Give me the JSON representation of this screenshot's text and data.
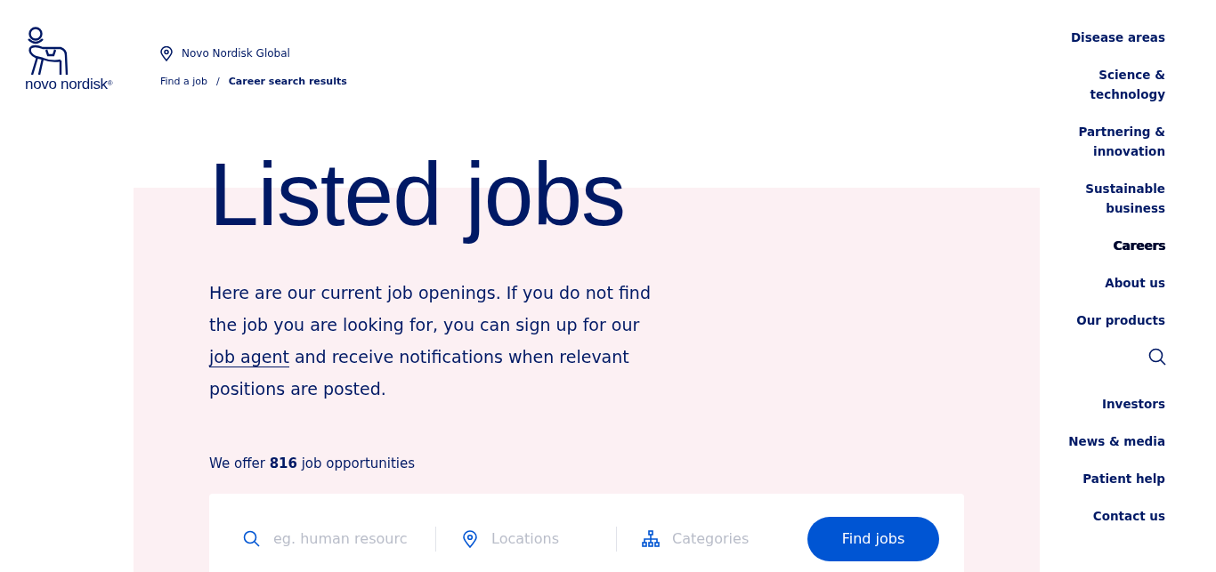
{
  "logo": {
    "text": "novo nordisk",
    "mark": "®"
  },
  "site": "Novo Nordisk Global",
  "breadcrumb": {
    "separator": "/",
    "items": [
      {
        "label": "Find a job",
        "current": false
      },
      {
        "label": "Career search results",
        "current": true
      }
    ]
  },
  "heading": "Listed jobs",
  "intro": {
    "before": "Here are our current job openings. If you do not find the job you are looking for, you can sign up for our",
    "link": "job agent",
    "after": "and receive notifications when relevant positions are posted."
  },
  "count_text": "We offer **816** job opportunities",
  "search": {
    "fields": [
      {
        "kind": "keyword",
        "placeholder": "eg. human resourc"
      },
      {
        "kind": "location",
        "placeholder": "Locations"
      },
      {
        "kind": "category",
        "placeholder": "Categories"
      }
    ],
    "button": "Find jobs"
  },
  "nav": {
    "primary": [
      {
        "label": "Disease areas",
        "selected": false
      },
      {
        "label": "Science & technology",
        "selected": false
      },
      {
        "label": "Partnering & innovation",
        "selected": false
      },
      {
        "label": "Sustainable business",
        "selected": false
      },
      {
        "label": "Careers",
        "selected": true
      },
      {
        "label": "About us",
        "selected": false
      },
      {
        "label": "Our products",
        "selected": false
      }
    ],
    "secondary": [
      {
        "label": "Investors",
        "selected": false
      },
      {
        "label": "News & media",
        "selected": false
      },
      {
        "label": "Patient help",
        "selected": false
      },
      {
        "label": "Contact us",
        "selected": false
      }
    ]
  }
}
